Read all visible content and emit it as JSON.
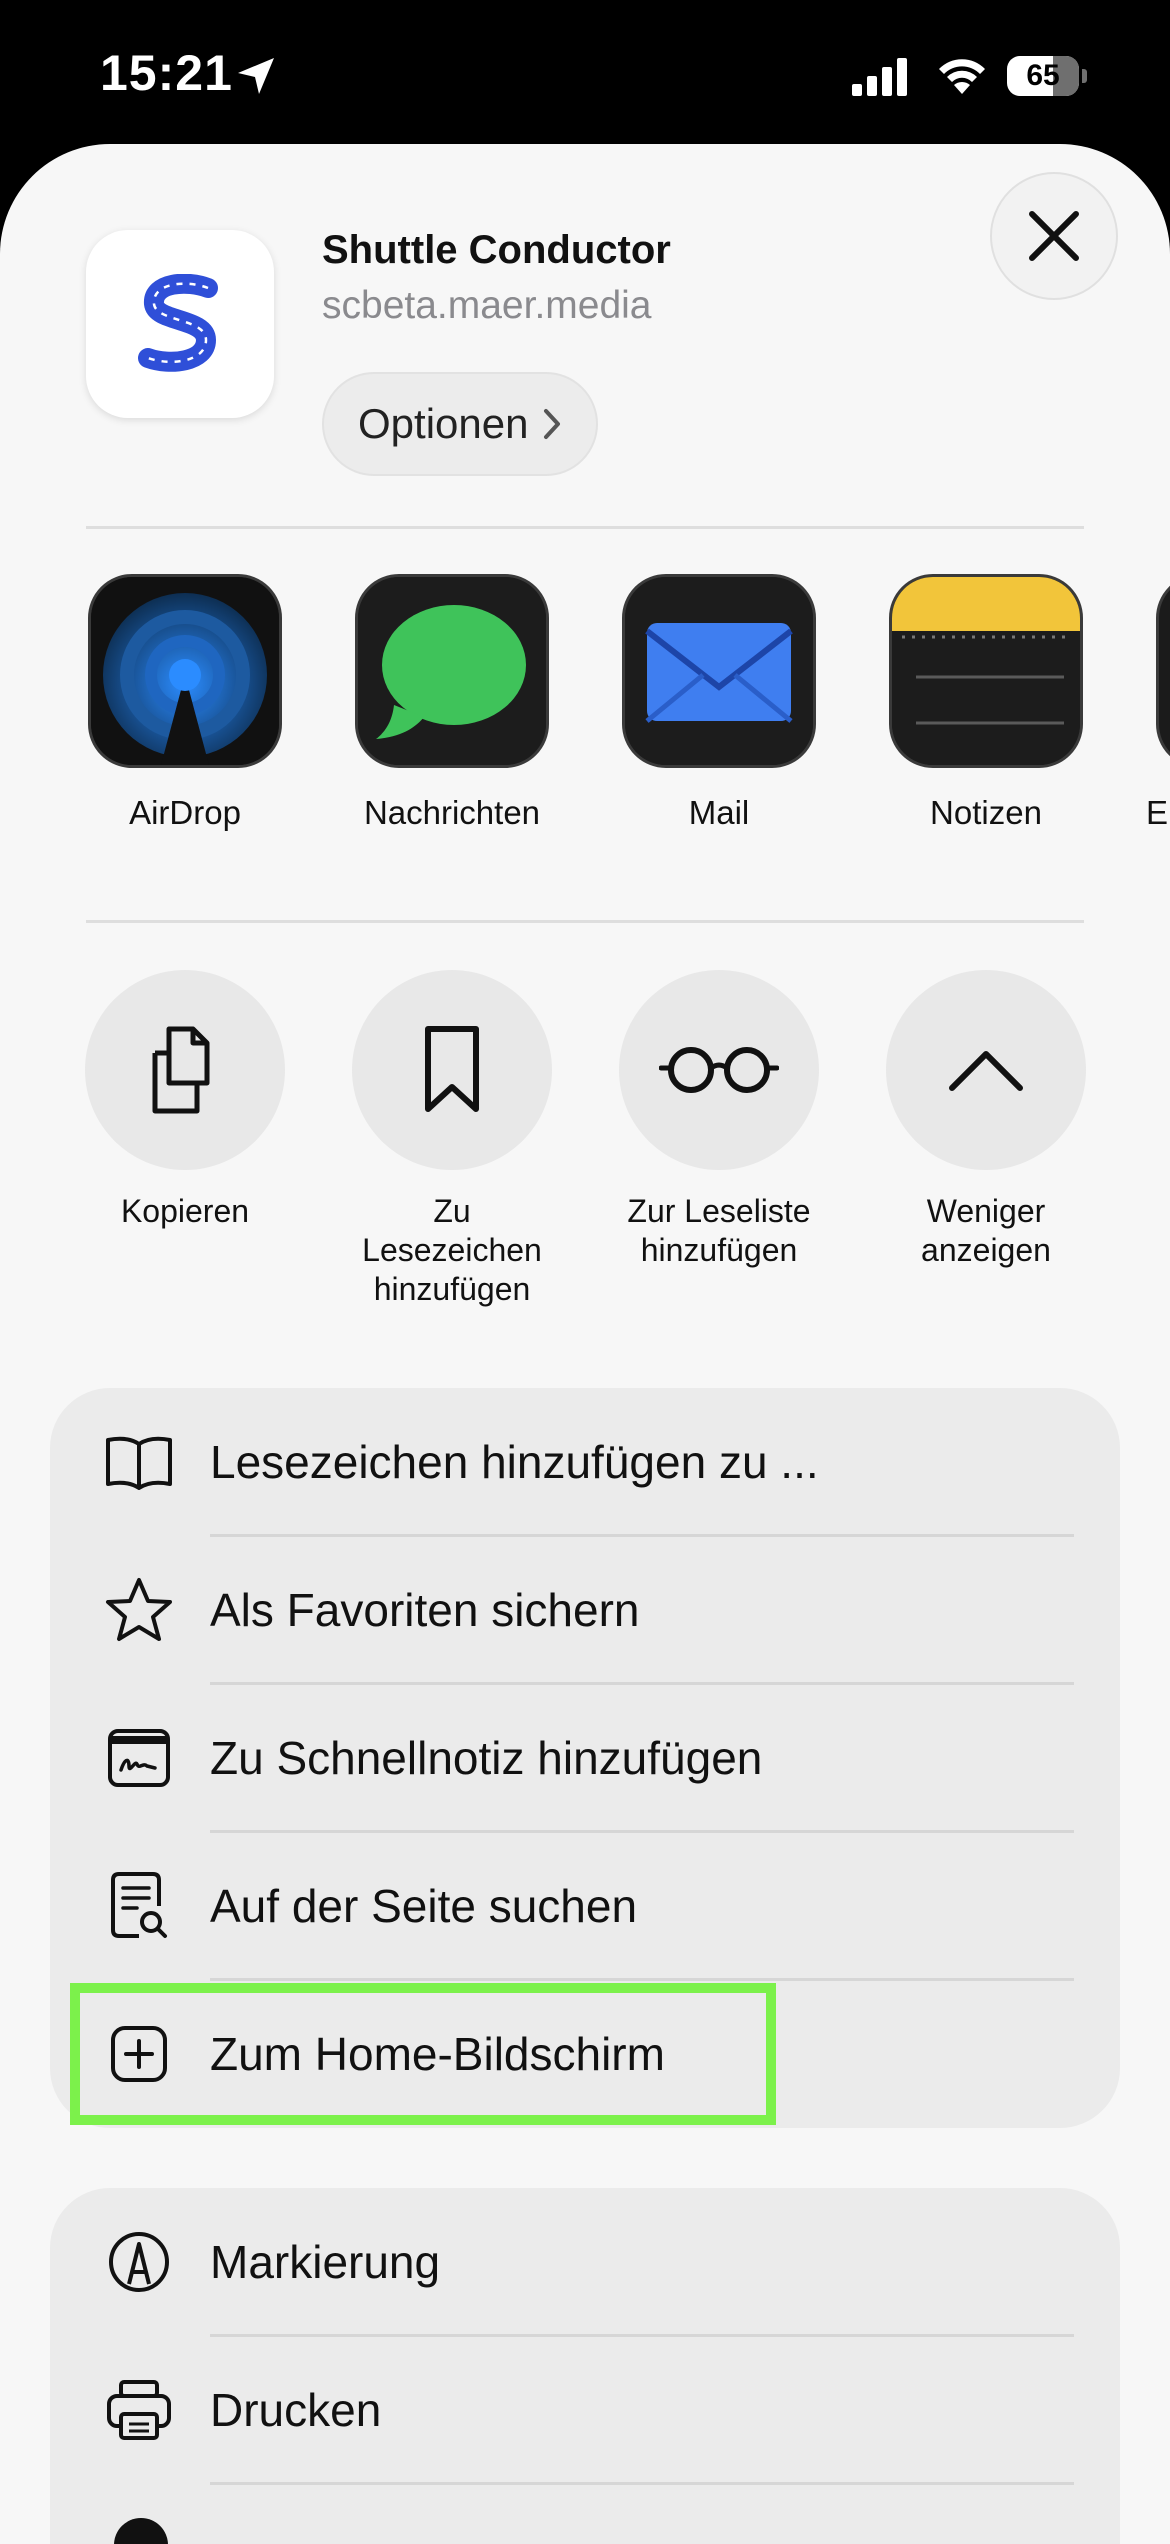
{
  "status_bar": {
    "time": "15:21",
    "battery": "65"
  },
  "header": {
    "title": "Shuttle Conductor",
    "url": "scbeta.maer.media",
    "options_label": "Optionen"
  },
  "share_apps": [
    {
      "label": "AirDrop"
    },
    {
      "label": "Nachrichten"
    },
    {
      "label": "Mail"
    },
    {
      "label": "Notizen"
    },
    {
      "label": "E"
    }
  ],
  "actions": [
    {
      "line1": "Kopieren",
      "line2": "",
      "line3": ""
    },
    {
      "line1": "Zu",
      "line2": "Lesezeichen",
      "line3": "hinzufügen"
    },
    {
      "line1": "Zur Leseliste",
      "line2": "hinzufügen",
      "line3": ""
    },
    {
      "line1": "Weniger",
      "line2": "anzeigen",
      "line3": ""
    }
  ],
  "menu1": [
    {
      "label": "Lesezeichen hinzufügen zu ..."
    },
    {
      "label": "Als Favoriten sichern"
    },
    {
      "label": "Zu Schnellnotiz hinzufügen"
    },
    {
      "label": "Auf der Seite suchen"
    },
    {
      "label": "Zum Home-Bildschirm"
    }
  ],
  "menu2": [
    {
      "label": "Markierung"
    },
    {
      "label": "Drucken"
    }
  ],
  "colors": {
    "highlight": "#7cf14b",
    "app_blue": "#2f4fd8",
    "sheet_bg": "#f7f7f7"
  }
}
